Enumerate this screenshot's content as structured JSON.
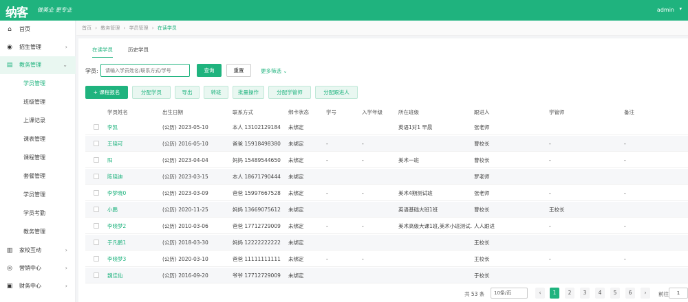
{
  "header": {
    "logo": "纳客",
    "slogan": "做美业 更专业",
    "user": "admin",
    "caret": "▾"
  },
  "sidebar": {
    "items": [
      {
        "label": "首页",
        "icon": "⌂",
        "arrow": ""
      },
      {
        "label": "招生管理",
        "icon": "◉",
        "arrow": "›"
      },
      {
        "label": "教务管理",
        "icon": "▤",
        "arrow": "⌄"
      }
    ],
    "sub_items": [
      "学员管理",
      "班级管理",
      "上课记录",
      "课表管理",
      "课程管理",
      "套餐管理",
      "学员管理",
      "学员考勤",
      "教务管理"
    ],
    "bottom_items": [
      {
        "label": "家校互动",
        "icon": "▥",
        "arrow": "›"
      },
      {
        "label": "营销中心",
        "icon": "◎",
        "arrow": "›"
      },
      {
        "label": "财务中心",
        "icon": "▣",
        "arrow": "›"
      }
    ]
  },
  "breadcrumb": [
    "首页",
    "›",
    "教务管理",
    "›",
    "学员管理",
    "›",
    "在读学员"
  ],
  "tabs": [
    "在读学员",
    "历史学员"
  ],
  "search": {
    "label": "学员:",
    "placeholder": "请输入学员姓名/联系方式/学号",
    "query": "查询",
    "reset": "重置",
    "more": "更多筛选 ⌄"
  },
  "actions": [
    "+ 课程报名",
    "分配学员",
    "导出",
    "转班",
    "批量操作",
    "分配学管师",
    "分配跟进人"
  ],
  "columns": [
    "学员姓名",
    "出生日期",
    "联系方式",
    "绑卡状态",
    "学号",
    "入学年级",
    "所在班级",
    "跟进人",
    "学管师",
    "备注"
  ],
  "rows": [
    {
      "name": "李凯",
      "birth": "(公历) 2023-05-10",
      "phone": "本人 13102129184",
      "status": "未绑定",
      "sid": "",
      "grade": "",
      "class": "英语1对1 早晨",
      "follow": "张老师",
      "mgr": "",
      "remark": ""
    },
    {
      "name": "王晓可",
      "birth": "(公历) 2016-05-10",
      "phone": "爸爸 15918498380",
      "status": "未绑定",
      "sid": "-",
      "grade": "-",
      "class": "",
      "follow": "曹校长",
      "mgr": "-",
      "remark": "-"
    },
    {
      "name": "阳",
      "birth": "(公历) 2023-04-04",
      "phone": "妈妈 15489544650",
      "status": "未绑定",
      "sid": "-",
      "grade": "-",
      "class": "美术一班",
      "follow": "曹校长",
      "mgr": "-",
      "remark": "-"
    },
    {
      "name": "陈晓迪",
      "birth": "(公历) 2023-03-15",
      "phone": "本人 18671790444",
      "status": "未绑定",
      "sid": "",
      "grade": "",
      "class": "",
      "follow": "罗老师",
      "mgr": "",
      "remark": ""
    },
    {
      "name": "李梦晓0",
      "birth": "(公历) 2023-03-09",
      "phone": "爸爸 15997667528",
      "status": "未绑定",
      "sid": "-",
      "grade": "-",
      "class": "美术4期测试班",
      "follow": "张老师",
      "mgr": "-",
      "remark": "-"
    },
    {
      "name": "小鹏",
      "birth": "(公历) 2020-11-25",
      "phone": "妈妈 13669075612",
      "status": "未绑定",
      "sid": "",
      "grade": "",
      "class": "英语基础大班1班",
      "follow": "曹校长",
      "mgr": "王校长",
      "remark": ""
    },
    {
      "name": "李晓梦2",
      "birth": "(公历) 2010-03-06",
      "phone": "爸爸 17712729009",
      "status": "未绑定",
      "sid": "-",
      "grade": "-",
      "class": "美术高级大课1班,美术小班测试…",
      "follow": "人人跟进",
      "mgr": "-",
      "remark": "-"
    },
    {
      "name": "于凡鹏1",
      "birth": "(公历) 2018-03-30",
      "phone": "妈妈 12222222222",
      "status": "未绑定",
      "sid": "",
      "grade": "",
      "class": "",
      "follow": "王校长",
      "mgr": "",
      "remark": ""
    },
    {
      "name": "李晓梦3",
      "birth": "(公历) 2020-03-10",
      "phone": "爸爸 11111111111",
      "status": "未绑定",
      "sid": "-",
      "grade": "-",
      "class": "",
      "follow": "王校长",
      "mgr": "-",
      "remark": "-"
    },
    {
      "name": "魏佳仙",
      "birth": "(公历) 2016-09-20",
      "phone": "爷爷 17712729009",
      "status": "未绑定",
      "sid": "",
      "grade": "",
      "class": "",
      "follow": "于校长",
      "mgr": "",
      "remark": ""
    }
  ],
  "pagination": {
    "total": "共 53 条",
    "page_size": "10条/页",
    "prev": "‹",
    "next": "›",
    "pages": [
      "1",
      "2",
      "3",
      "4",
      "5",
      "6"
    ],
    "goto": "前往",
    "goto_value": "1"
  },
  "colors": {
    "accent": "#1fb37e"
  }
}
